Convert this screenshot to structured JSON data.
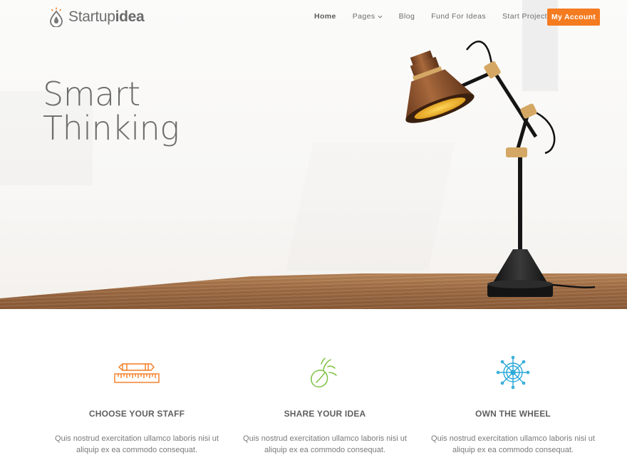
{
  "brand": {
    "logo_regular": "Startup",
    "logo_bold": "idea",
    "logo_icon": "drop-lightbulb-icon"
  },
  "nav": {
    "items": [
      {
        "label": "Home",
        "active": true
      },
      {
        "label": "Pages",
        "has_dropdown": true
      },
      {
        "label": "Blog"
      },
      {
        "label": "Fund For Ideas"
      },
      {
        "label": "Start Project"
      }
    ],
    "account_button": "My Account"
  },
  "hero": {
    "title_line1": "Smart",
    "title_line2": "Thinking",
    "image": "desk-lamp-on-wooden-table"
  },
  "features": [
    {
      "icon": "ruler-pencil-icon",
      "icon_color": "#f47b20",
      "title": "CHOOSE YOUR STAFF",
      "text_line1": "Quis nostrud exercitation ullamco laboris nisi ut",
      "text_line2": "aliquip ex ea commodo consequat."
    },
    {
      "icon": "seed-sprout-icon",
      "icon_color": "#7dc142",
      "title": "SHARE YOUR IDEA",
      "text_line1": "Quis nostrud exercitation ullamco laboris nisi ut",
      "text_line2": "aliquip ex ea commodo consequat."
    },
    {
      "icon": "ship-wheel-icon",
      "icon_color": "#29a8d8",
      "title": "OWN THE WHEEL",
      "text_line1": "Quis nostrud exercitation ullamco laboris nisi ut",
      "text_line2": "aliquip ex ea commodo consequat."
    }
  ],
  "colors": {
    "accent": "#f47b20",
    "green": "#7dc142",
    "blue": "#29a8d8",
    "text": "#5a5a5a"
  }
}
